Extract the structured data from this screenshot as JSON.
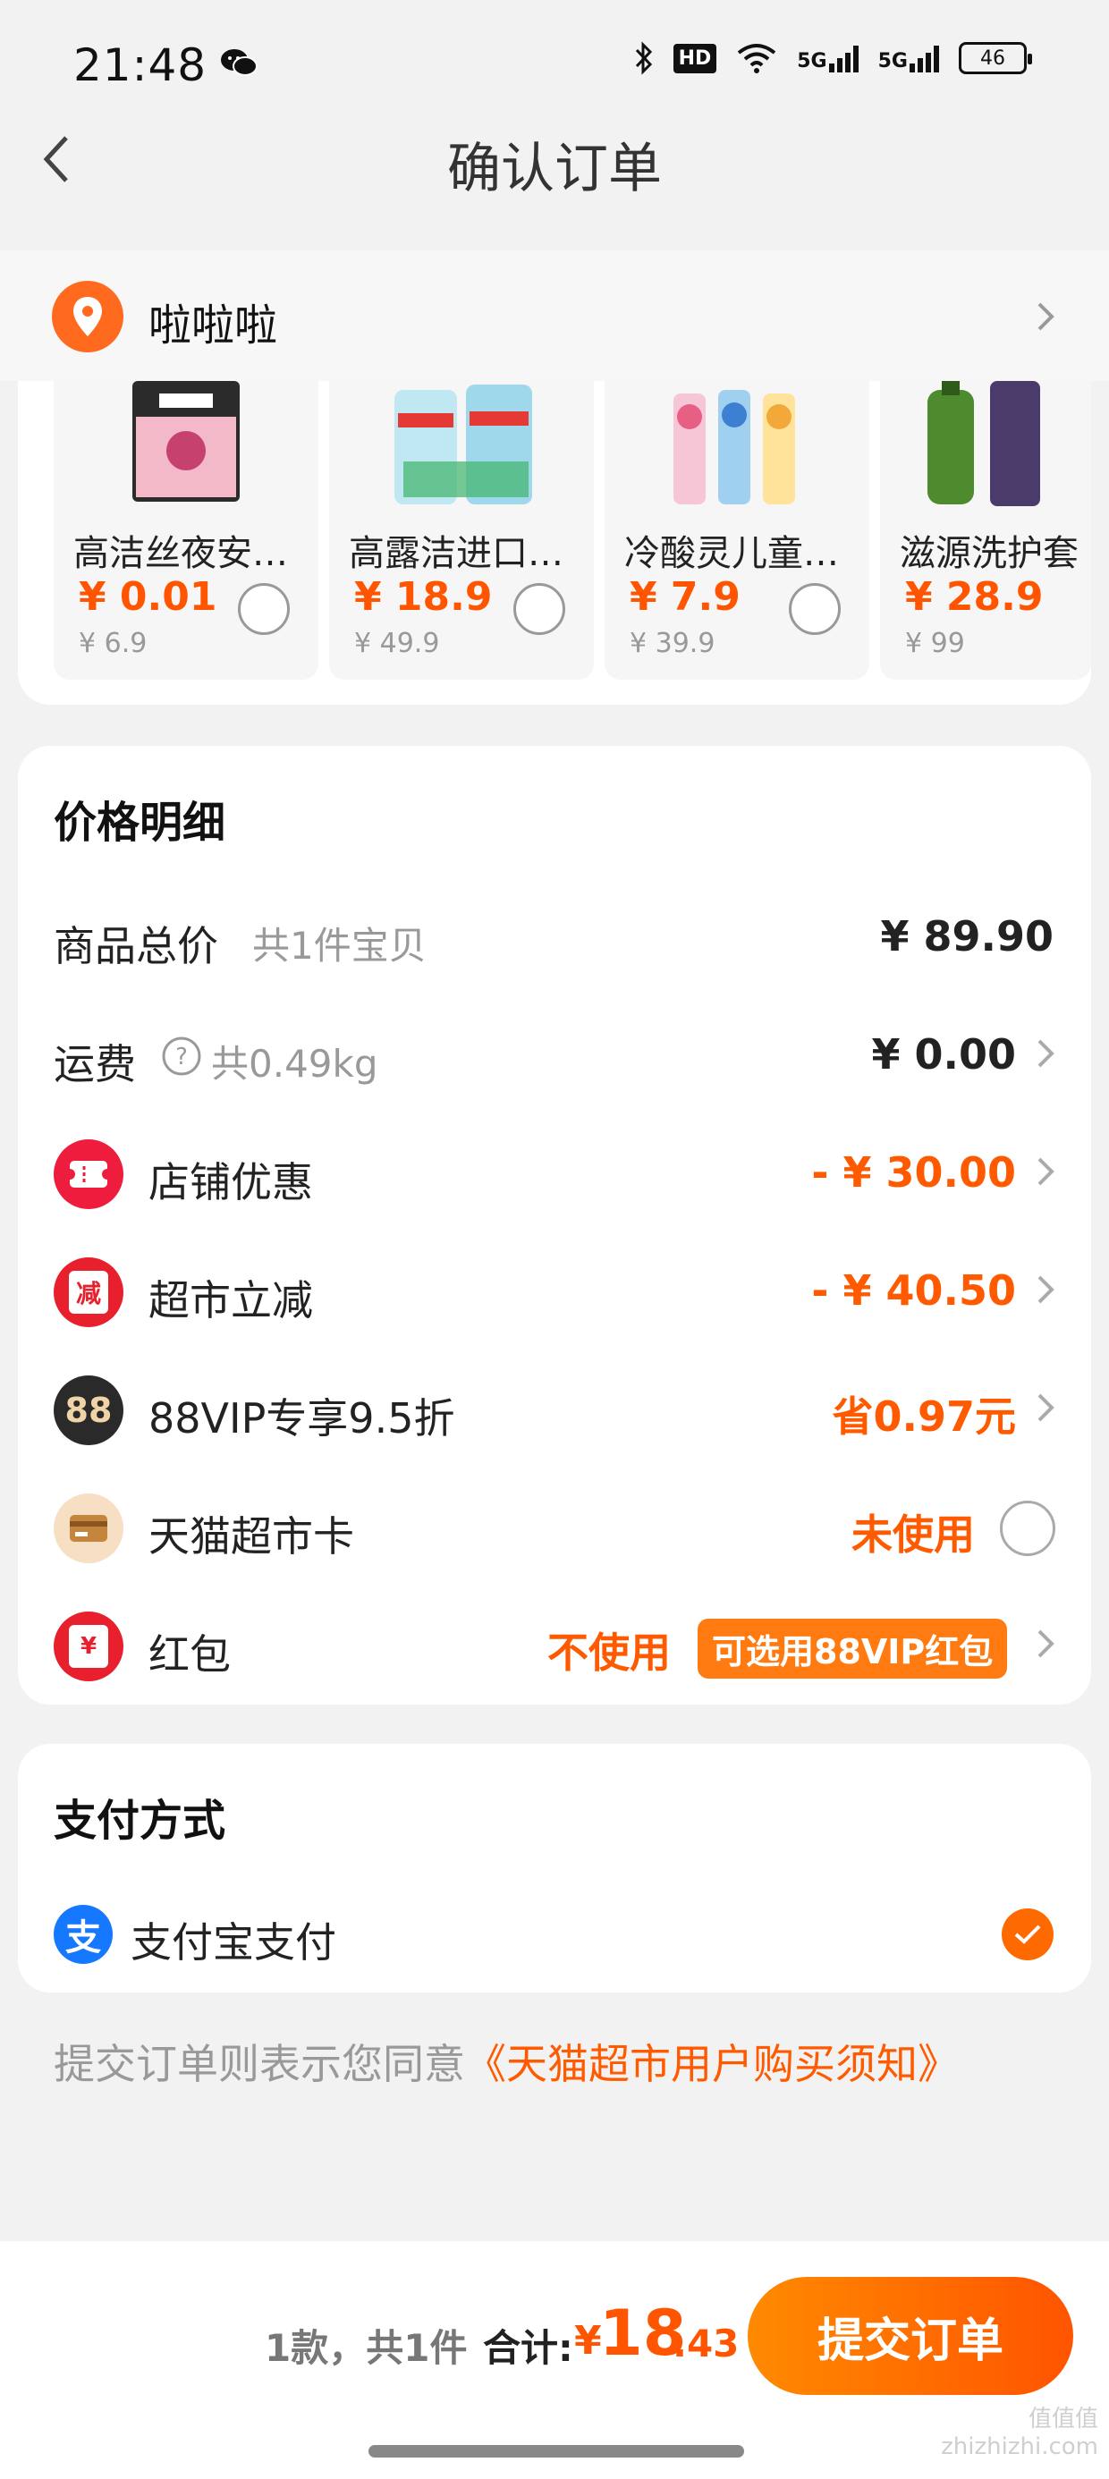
{
  "status_bar": {
    "time": "21:48",
    "hd_label": "HD",
    "net1": "5G",
    "net2": "5G",
    "battery": "46",
    "icons": [
      "wechat-icon",
      "bluetooth-icon",
      "hd-icon",
      "wifi-icon",
      "signal-5g-icon",
      "signal-5g-icon",
      "battery-icon"
    ]
  },
  "header": {
    "title": "确认订单"
  },
  "address": {
    "name": "啦啦啦"
  },
  "products": [
    {
      "name": "高洁丝夜安裤…",
      "price": "¥ 0.01",
      "original": "¥ 6.9"
    },
    {
      "name": "高露洁进口抑…",
      "price": "¥ 18.9",
      "original": "¥ 49.9"
    },
    {
      "name": "冷酸灵儿童牙…",
      "price": "¥ 7.9",
      "original": "¥ 39.9"
    },
    {
      "name": "滋源洗护套",
      "price": "¥ 28.9",
      "original": "¥ 99"
    }
  ],
  "price_detail": {
    "title": "价格明细",
    "goods_label": "商品总价",
    "goods_sub": "共1件宝贝",
    "goods_value": "¥ 89.90",
    "shipping_label": "运费",
    "shipping_sub": "共0.49kg",
    "shipping_value": "¥ 0.00",
    "shop_label": "店铺优惠",
    "shop_value": "- ¥ 30.00",
    "market_label": "超市立减",
    "market_value": "- ¥ 40.50",
    "market_icon_text": "减",
    "vip_label": "88VIP专享9.5折",
    "vip_value": "省0.97元",
    "vip_icon_text": "88",
    "card_label": "天猫超市卡",
    "card_value": "未使用",
    "redpack_label": "红包",
    "redpack_value": "不使用",
    "redpack_badge": "可选用88VIP红包",
    "redpack_icon_text": "¥"
  },
  "payment": {
    "title": "支付方式",
    "method": "支付宝支付",
    "alipay_char": "支"
  },
  "agreement": {
    "prefix": "提交订单则表示您同意",
    "link": "《天猫超市用户购买须知》"
  },
  "bottom": {
    "count": "1款，共1件",
    "total_label": "合计:",
    "currency": "¥",
    "total_int": "18",
    "total_dec": ".43",
    "submit": "提交订单"
  },
  "watermark": {
    "line1": "值值值",
    "line2": "zhizhizhi.com"
  },
  "colors": {
    "accent": "#ff5a00",
    "alipay": "#1677ff"
  }
}
